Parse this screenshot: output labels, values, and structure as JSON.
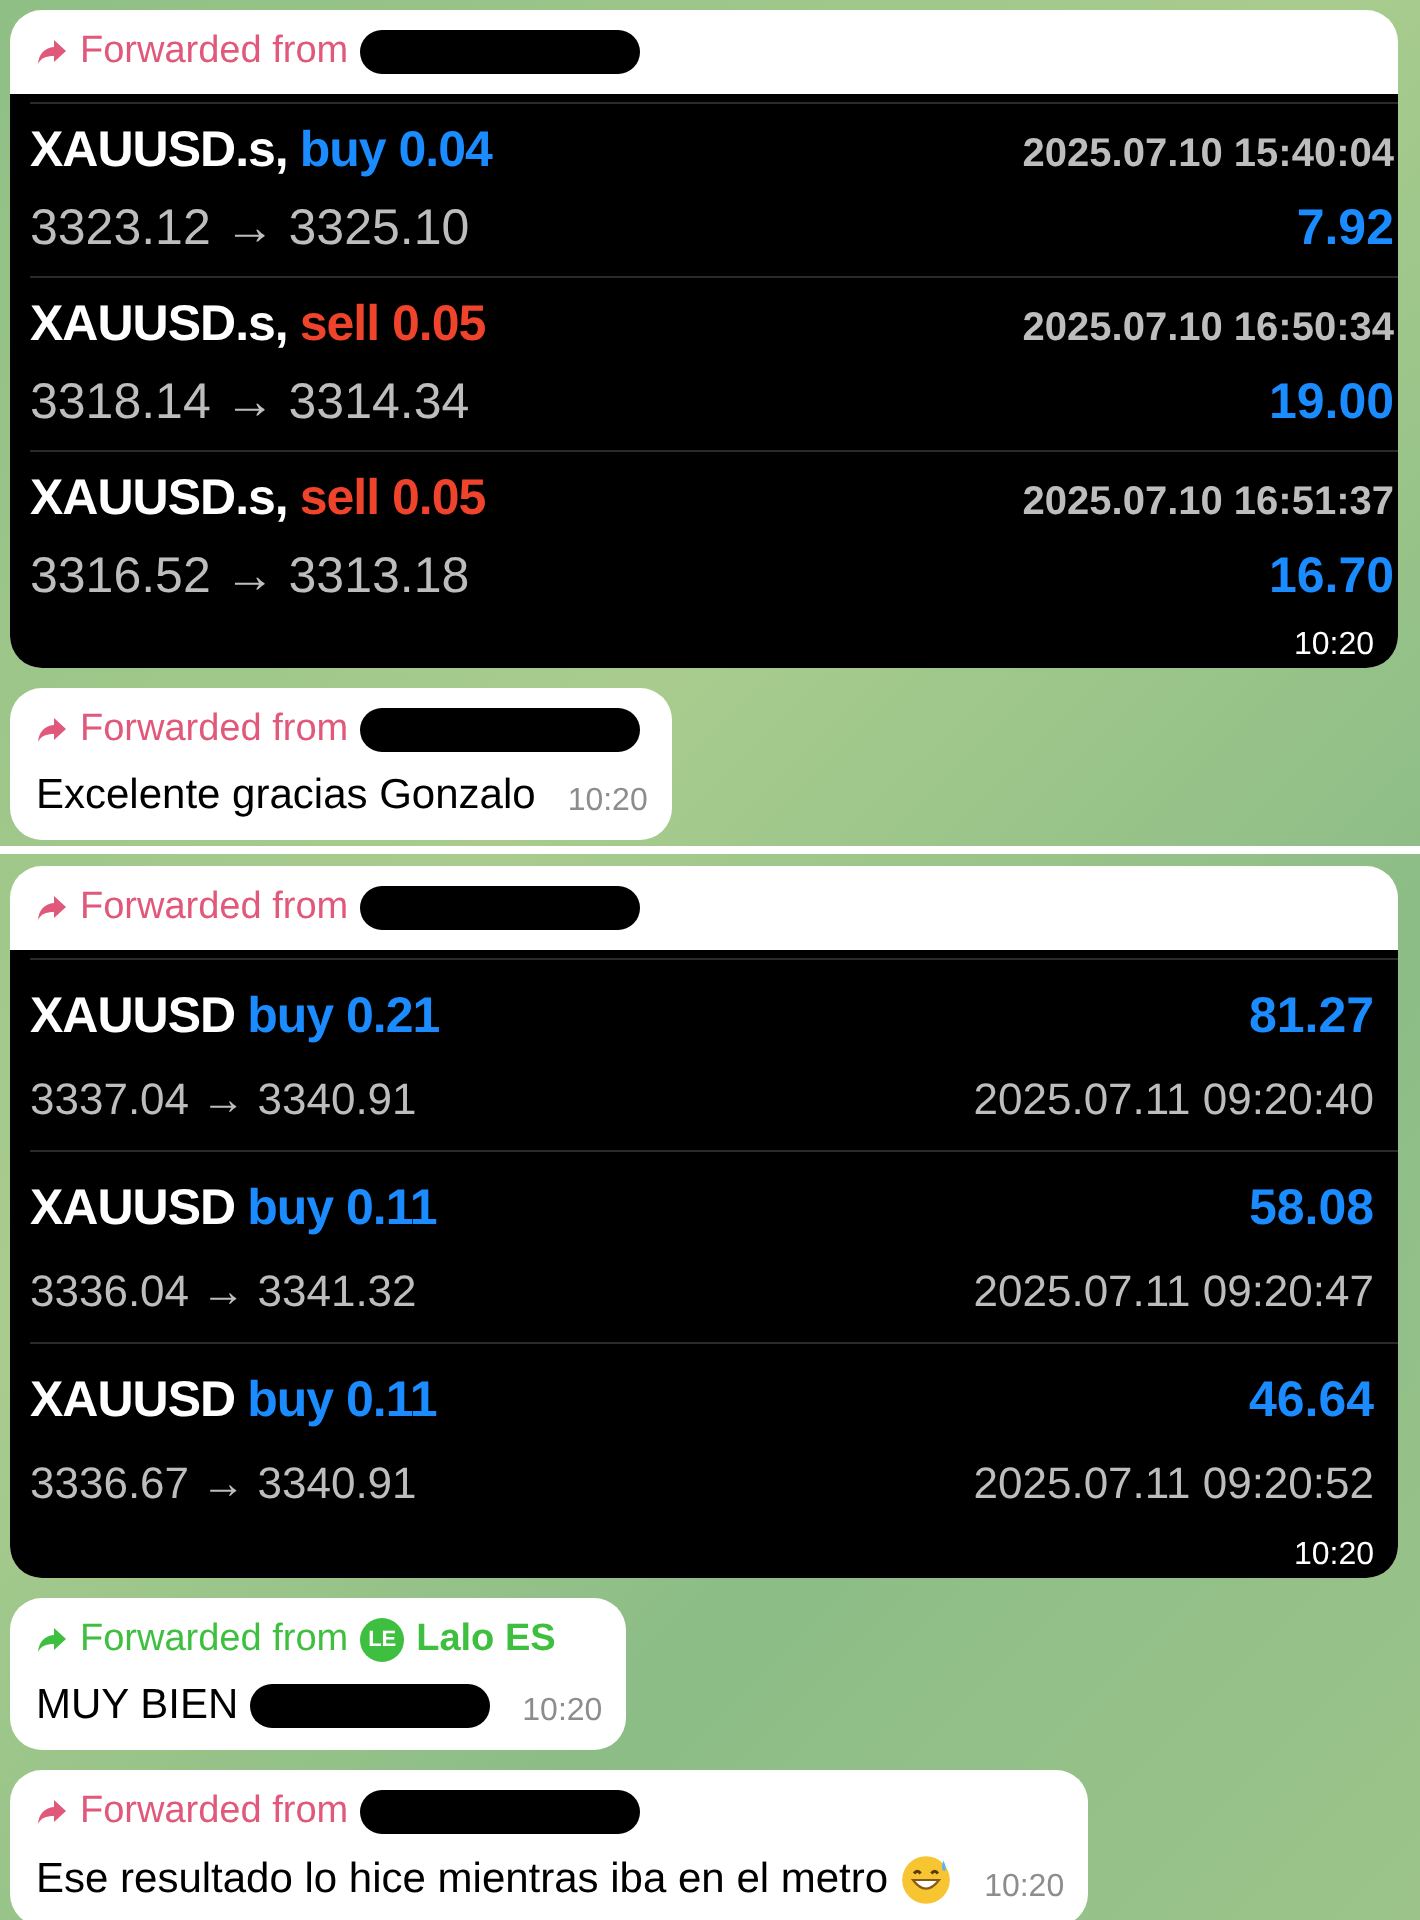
{
  "messages": [
    {
      "kind": "trades_date_right",
      "forwarded_label": "Forwarded from",
      "color": "#e0587a",
      "sender": {
        "redacted": true
      },
      "time": "10:20",
      "trades": [
        {
          "symbol": "XAUUSD.s,",
          "side": "buy 0.04",
          "color": "#1a8cff",
          "date": "2025.07.10 15:40:04",
          "prices": "3323.12 → 3325.10",
          "profit": "7.92"
        },
        {
          "symbol": "XAUUSD.s,",
          "side": "sell 0.05",
          "color": "#f0432c",
          "date": "2025.07.10 16:50:34",
          "prices": "3318.14 → 3314.34",
          "profit": "19.00"
        },
        {
          "symbol": "XAUUSD.s,",
          "side": "sell 0.05",
          "color": "#f0432c",
          "date": "2025.07.10 16:51:37",
          "prices": "3316.52 → 3313.18",
          "profit": "16.70"
        }
      ]
    },
    {
      "kind": "text",
      "forwarded_label": "Forwarded from",
      "color": "#e0587a",
      "sender": {
        "redacted": true
      },
      "text": "Excelente gracias Gonzalo",
      "time": "10:20"
    },
    {
      "kind": "break"
    },
    {
      "kind": "trades_profit_right",
      "forwarded_label": "Forwarded from",
      "color": "#e0587a",
      "sender": {
        "redacted": true
      },
      "time": "10:20",
      "trades": [
        {
          "symbol": "XAUUSD",
          "side": "buy 0.21",
          "color": "#1a8cff",
          "date": "2025.07.11 09:20:40",
          "prices": "3337.04 → 3340.91",
          "profit": "81.27"
        },
        {
          "symbol": "XAUUSD",
          "side": "buy 0.11",
          "color": "#1a8cff",
          "date": "2025.07.11 09:20:47",
          "prices": "3336.04 → 3341.32",
          "profit": "58.08"
        },
        {
          "symbol": "XAUUSD",
          "side": "buy 0.11",
          "color": "#1a8cff",
          "date": "2025.07.11 09:20:52",
          "prices": "3336.67 → 3340.91",
          "profit": "46.64"
        }
      ]
    },
    {
      "kind": "text",
      "forwarded_label": "Forwarded from",
      "color": "#3fbf3f",
      "sender": {
        "redacted": false,
        "name": "Lalo ES",
        "avatar": "LE"
      },
      "text": "MUY BIEN",
      "text_redacted": true,
      "time": "10:20"
    },
    {
      "kind": "text",
      "forwarded_label": "Forwarded from",
      "color": "#e0587a",
      "sender": {
        "redacted": true
      },
      "text": "Ese resultado lo hice mientras iba en el metro",
      "emoji": true,
      "time": "10:20"
    }
  ]
}
